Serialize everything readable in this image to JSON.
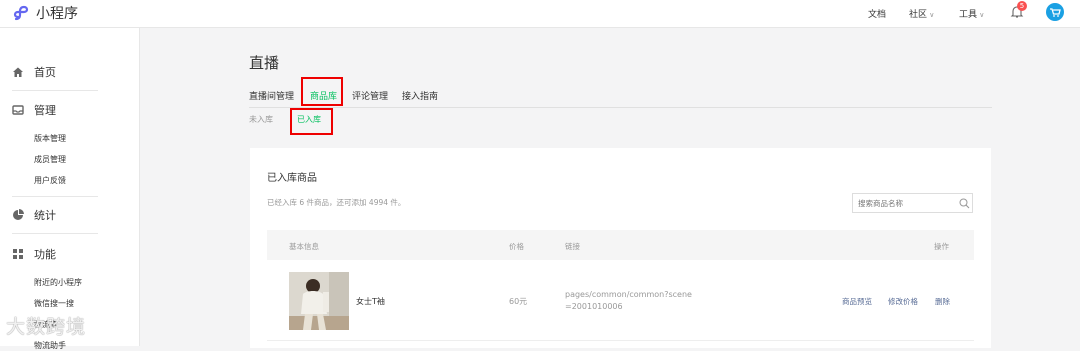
{
  "app": {
    "title": "小程序"
  },
  "topnav": {
    "docs": "文档",
    "community": "社区",
    "tools": "工具",
    "notifications": "5"
  },
  "sidebar": {
    "home": "首页",
    "manage": "管理",
    "manage_items": [
      "版本管理",
      "成员管理",
      "用户反馈"
    ],
    "stats": "统计",
    "features": "功能",
    "feature_items": [
      "附近的小程序",
      "微信搜一搜",
      "物流查",
      "物流助手"
    ]
  },
  "page": {
    "title": "直播"
  },
  "tabs": [
    "直播间管理",
    "商品库",
    "评论管理",
    "接入指南"
  ],
  "subtabs": [
    "未入库",
    "已入库"
  ],
  "card": {
    "title": "已入库商品",
    "note": "已经入库 6 件商品，还可添加 4994 件。",
    "search_placeholder": "搜索商品名称"
  },
  "table": {
    "headers": {
      "basic": "基本信息",
      "price": "价格",
      "link": "链接",
      "actions": "操作"
    },
    "rows": [
      {
        "name": "女士T袖",
        "price": "60元",
        "link_line1": "pages/common/common?scene",
        "link_line2": "=2001010006",
        "preview": "商品预览",
        "edit": "修改价格",
        "delete": "删除"
      }
    ]
  },
  "watermark": "大数跨境",
  "colors": {
    "accent": "#07c160",
    "highlight": "#e00000",
    "link": "#576b95"
  }
}
